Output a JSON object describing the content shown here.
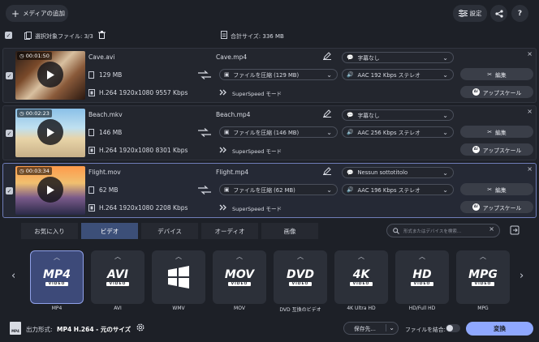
{
  "toolbar": {
    "add_media": "メディアの追加",
    "settings": "設定",
    "share_icon": "share-icon",
    "help": "?"
  },
  "selection": {
    "selected_files": "選択対象ファイル: 3/3",
    "total_size": "合計サイズ: 336 MB"
  },
  "files": [
    {
      "duration": "00:01:50",
      "name": "Cave.avi",
      "size": "129 MB",
      "codec": "H.264 1920x1080 9557 Kbps",
      "output_name": "Cave.mp4",
      "compress": "ファイルを圧縮 (129 MB)",
      "superspeed": "SuperSpeed モード",
      "subtitle": "字幕なし",
      "audio": "AAC 192 Kbps ステレオ",
      "edit": "編集",
      "upscale": "アップスケール"
    },
    {
      "duration": "00:02:23",
      "name": "Beach.mkv",
      "size": "146 MB",
      "codec": "H.264 1920x1080 8301 Kbps",
      "output_name": "Beach.mp4",
      "compress": "ファイルを圧縮 (146 MB)",
      "superspeed": "SuperSpeed モード",
      "subtitle": "字幕なし",
      "audio": "AAC 256 Kbps ステレオ",
      "edit": "編集",
      "upscale": "アップスケール"
    },
    {
      "duration": "00:03:34",
      "name": "Flight.mov",
      "size": "62 MB",
      "codec": "H.264 1920x1080 2208 Kbps",
      "output_name": "Flight.mp4",
      "compress": "ファイルを圧縮 (62 MB)",
      "superspeed": "SuperSpeed モード",
      "subtitle": "Nessun sottotitolo",
      "audio": "AAC 196 Kbps ステレオ",
      "edit": "編集",
      "upscale": "アップスケール"
    }
  ],
  "tabs": [
    "お気に入り",
    "ビデオ",
    "デバイス",
    "オーディオ",
    "画像"
  ],
  "search": {
    "placeholder": "形式またはデバイスを検索..."
  },
  "formats": [
    {
      "logo": "MP4",
      "sub": "VIDEO",
      "label": "MP4"
    },
    {
      "logo": "AVI",
      "sub": "VIDEO",
      "label": "AVI"
    },
    {
      "logo": "",
      "sub": "",
      "label": "WMV"
    },
    {
      "logo": "MOV",
      "sub": "VIDEO",
      "label": "MOV"
    },
    {
      "logo": "DVD",
      "sub": "VIDEO",
      "label": "DVD 互換のビデオ"
    },
    {
      "logo": "4K",
      "sub": "VIDEO",
      "label": "4K Ultra HD"
    },
    {
      "logo": "HD",
      "sub": "VIDEO",
      "label": "HD/Full HD"
    },
    {
      "logo": "MPG",
      "sub": "VIDEO",
      "label": "MPG"
    }
  ],
  "footer": {
    "output_label": "出力形式:",
    "output_value": "MP4 H.264 - 元のサイズ",
    "save_to": "保存先...",
    "merge": "ファイルを結合:",
    "convert": "変換",
    "mp4_badge": "MP4"
  },
  "colors": {
    "accent": "#8fa8ff",
    "background": "#1d2027",
    "selected_tile": "#3d4a79"
  }
}
